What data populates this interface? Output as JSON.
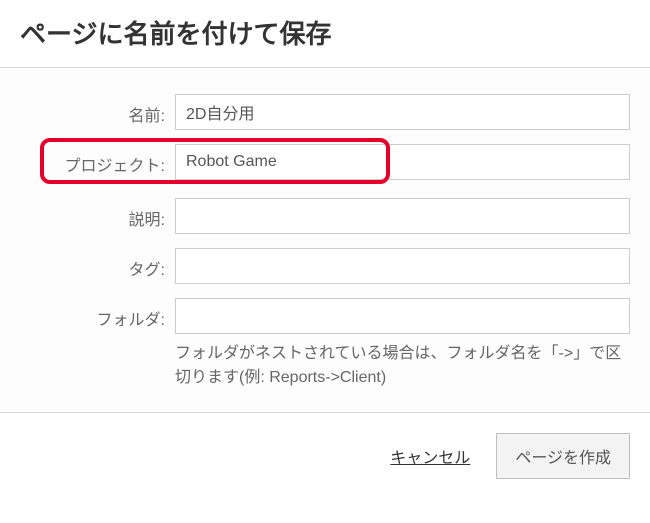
{
  "dialog": {
    "title": "ページに名前を付けて保存"
  },
  "form": {
    "name": {
      "label": "名前:",
      "value": "2D自分用"
    },
    "project": {
      "label": "プロジェクト:",
      "value": "Robot Game"
    },
    "description": {
      "label": "説明:",
      "value": ""
    },
    "tags": {
      "label": "タグ:",
      "value": ""
    },
    "folder": {
      "label": "フォルダ:",
      "value": "",
      "help": "フォルダがネストされている場合は、フォルダ名を「->」で区切ります(例: Reports->Client)"
    }
  },
  "footer": {
    "cancel": "キャンセル",
    "submit": "ページを作成"
  },
  "highlight": {
    "target_name": "project-field"
  }
}
